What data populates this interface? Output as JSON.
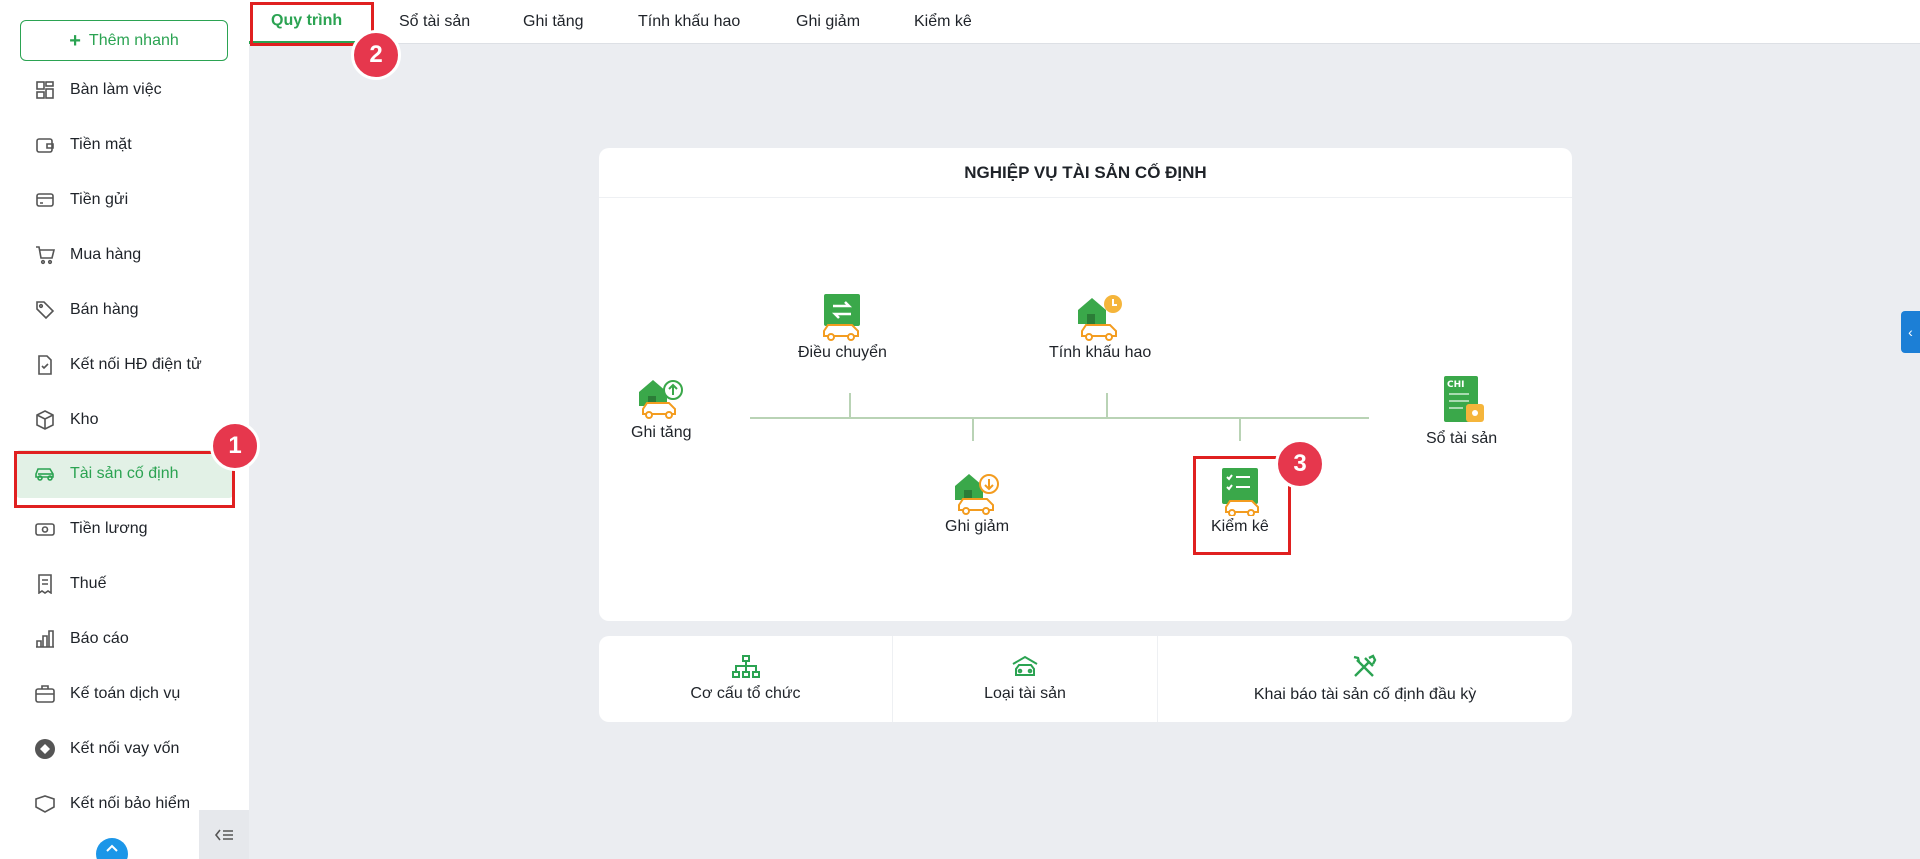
{
  "sidebar": {
    "quick_add_label": "Thêm nhanh",
    "items": [
      {
        "label": "Bàn làm việc",
        "icon": "dashboard-icon"
      },
      {
        "label": "Tiền mặt",
        "icon": "wallet-icon"
      },
      {
        "label": "Tiền gửi",
        "icon": "card-icon"
      },
      {
        "label": "Mua hàng",
        "icon": "cart-icon"
      },
      {
        "label": "Bán hàng",
        "icon": "tag-icon"
      },
      {
        "label": "Kết nối HĐ điện tử",
        "icon": "invoice-icon"
      },
      {
        "label": "Kho",
        "icon": "box-icon"
      },
      {
        "label": "Tài sản cố định",
        "icon": "car-icon"
      },
      {
        "label": "Tiền lương",
        "icon": "money-icon"
      },
      {
        "label": "Thuế",
        "icon": "receipt-icon"
      },
      {
        "label": "Báo cáo",
        "icon": "chart-icon"
      },
      {
        "label": "Kế toán dịch vụ",
        "icon": "briefcase-icon"
      },
      {
        "label": "Kết nối vay vốn",
        "icon": "loan-icon"
      },
      {
        "label": "Kết nối bảo hiểm",
        "icon": "car-insurance-icon"
      }
    ]
  },
  "tabs": [
    "Quy trình",
    "Sổ tài sản",
    "Ghi tăng",
    "Tính khấu hao",
    "Ghi giảm",
    "Kiểm kê"
  ],
  "badges": [
    "1",
    "2",
    "3"
  ],
  "card": {
    "title": "NGHIỆP VỤ TÀI SẢN CỐ ĐỊNH",
    "nodes": {
      "ghi_tang": "Ghi tăng",
      "dieu_chuyen": "Điều chuyển",
      "tinh_khau_hao": "Tính khấu hao",
      "ghi_giam": "Ghi giảm",
      "kiem_ke": "Kiểm kê",
      "so_tai_san": "Sổ tài sản",
      "so_tai_san_icon_text": "CHI"
    }
  },
  "bottom": {
    "co_cau": "Cơ cấu tổ chức",
    "loai_tai_san": "Loại tài sản",
    "khai_bao": "Khai báo tài sản cố định đầu kỳ"
  },
  "colors": {
    "accent": "#2ba352",
    "annotation_red": "#e02020",
    "badge": "#e6374d",
    "icon_orange": "#f39c1f",
    "icon_green": "#3aa84a"
  }
}
